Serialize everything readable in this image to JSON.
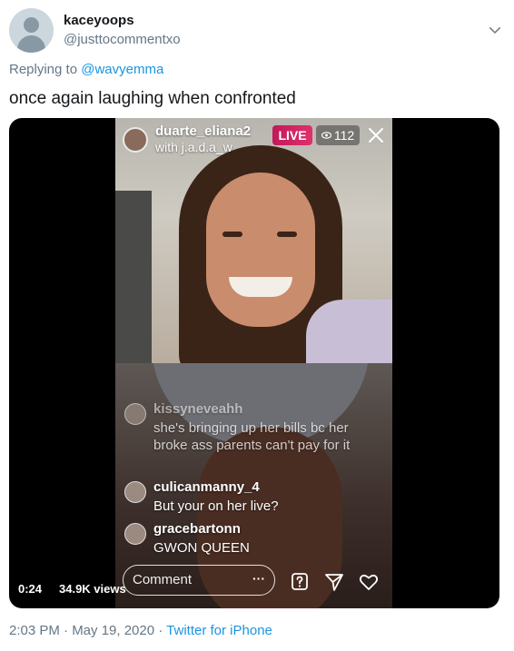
{
  "tweet": {
    "display_name": "kaceyoops",
    "handle": "@justtocommentxo",
    "replying_prefix": "Replying to",
    "replying_to": "@wavyemma",
    "text": "once again laughing when confronted",
    "timestamp": "2:03 PM · May 19, 2020 ·",
    "source": "Twitter for iPhone"
  },
  "video": {
    "elapsed": "0:24",
    "views": "34.9K views"
  },
  "live": {
    "host": "duarte_eliana2",
    "guest": "with j.a.d.a_w",
    "badge": "LIVE",
    "viewers": "112",
    "comments": [
      {
        "user": "kissyneveahh",
        "text": "she's bringing up her bills bc her broke ass parents can't pay for it"
      },
      {
        "user": "culicanmanny_4",
        "text": "But your on her live?"
      },
      {
        "user": "gracebartonn",
        "text": "GWON QUEEN"
      }
    ],
    "comment_placeholder": "Comment",
    "more_label": "···"
  },
  "colors": {
    "link": "#1b95e0",
    "muted": "#657786",
    "live_badge": "#e1306c"
  },
  "icons": [
    "chevron-down-icon",
    "eye-icon",
    "close-icon",
    "question-icon",
    "send-icon",
    "heart-icon"
  ]
}
